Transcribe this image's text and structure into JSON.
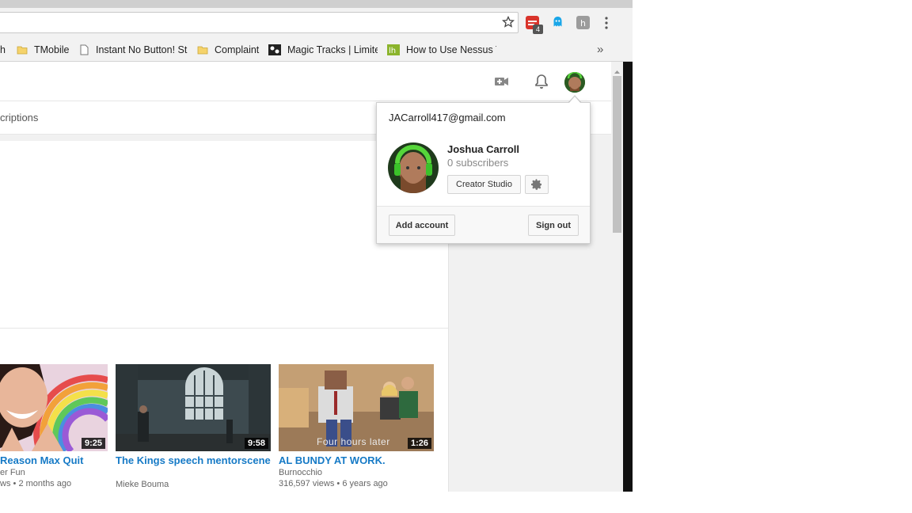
{
  "browser": {
    "bookmarks": [
      {
        "label": "h",
        "icon": "folder-icon"
      },
      {
        "label": "TMobile",
        "icon": "folder-icon"
      },
      {
        "label": "Instant No Button! St",
        "icon": "page-icon"
      },
      {
        "label": "Complaint",
        "icon": "folder-icon"
      },
      {
        "label": "Magic Tracks | Limitec",
        "icon": "magic-tracks-icon"
      },
      {
        "label": "How to Use Nessus T",
        "icon": "lh-icon"
      }
    ],
    "extension_badge": "4",
    "more_bookmarks": "»"
  },
  "page": {
    "subnav_label": "criptions"
  },
  "videos": [
    {
      "title": "Reason Max Quit",
      "duration": "9:25",
      "channel": "er Fun",
      "views": "ws",
      "age": "2 months ago"
    },
    {
      "title": "The Kings speech mentorscene",
      "duration": "9:58",
      "channel": "Mieke Bouma",
      "views": "",
      "age": ""
    },
    {
      "title": "AL BUNDY AT WORK.",
      "duration": "1:26",
      "channel": "Burnocchio",
      "views": "316,597 views",
      "age": "6 years ago",
      "thumb_caption": "Four hours later"
    }
  ],
  "account_popup": {
    "email": "JACarroll417@gmail.com",
    "name": "Joshua Carroll",
    "subscribers": "0 subscribers",
    "creator_studio_label": "Creator Studio",
    "add_account_label": "Add account",
    "sign_out_label": "Sign out"
  },
  "colors": {
    "link_blue": "#167ac6",
    "meta_gray": "#666666",
    "avatar_green": "#3a9a2a"
  }
}
